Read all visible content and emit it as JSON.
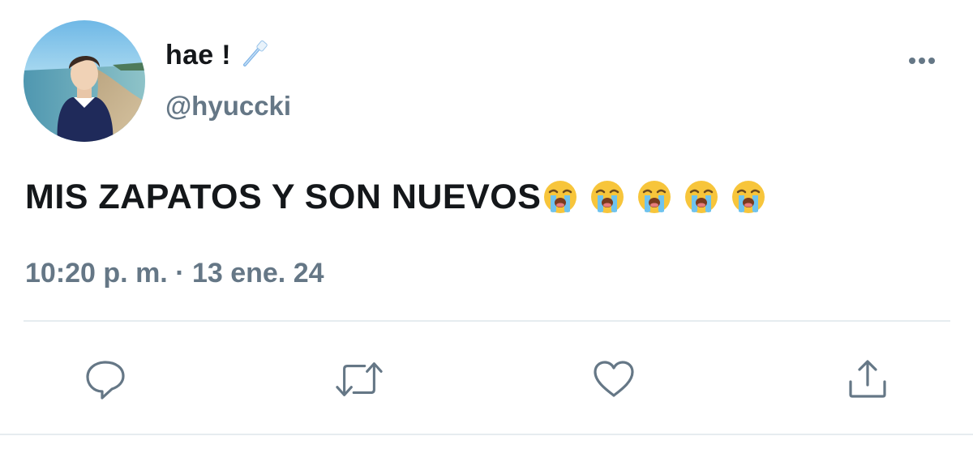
{
  "user": {
    "display_name": "hae !",
    "name_emoji_icon": "toothbrush-icon",
    "handle": "@hyuccki",
    "avatar_icon": "profile-photo"
  },
  "tweet": {
    "text": "MIS ZAPATOS Y SON NUEVOS",
    "emojis": [
      "loudly-crying-face",
      "loudly-crying-face",
      "loudly-crying-face",
      "loudly-crying-face",
      "loudly-crying-face"
    ],
    "timestamp": "10:20 p. m. · 13 ene. 24"
  },
  "actions": [
    {
      "name": "reply",
      "icon": "reply-icon"
    },
    {
      "name": "retweet",
      "icon": "retweet-icon"
    },
    {
      "name": "like",
      "icon": "heart-icon"
    },
    {
      "name": "share",
      "icon": "share-icon"
    }
  ],
  "menu": {
    "icon": "more-icon"
  },
  "colors": {
    "text_primary": "#14171a",
    "text_secondary": "#657786",
    "icon_gray": "#657786",
    "divider": "#e6ecf0"
  }
}
